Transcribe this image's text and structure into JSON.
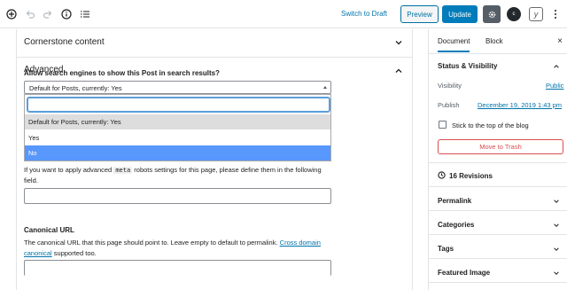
{
  "toolbar": {
    "icons": [
      "add-block-icon",
      "undo-icon",
      "redo-icon",
      "info-icon",
      "list-view-icon"
    ],
    "switch_to_draft": "Switch to Draft",
    "preview": "Preview",
    "update": "Update",
    "yoast_glyph": "y",
    "plugin_glyph": "c"
  },
  "main": {
    "panels": [
      {
        "title": "Cornerstone content",
        "state": "collapsed"
      },
      {
        "title": "Advanced",
        "state": "expanded"
      }
    ],
    "advanced": {
      "search_question": "Allow search engines to show this Post in search results?",
      "select_value": "Default for Posts, currently: Yes",
      "dropdown_options": [
        {
          "label": "Default for Posts, currently: Yes",
          "state": "selected"
        },
        {
          "label": "Yes",
          "state": ""
        },
        {
          "label": "No",
          "state": "highlighted"
        }
      ],
      "meta_desc_before": "If you want to apply advanced ",
      "meta_code": "meta",
      "meta_desc_after": " robots settings for this page, please define them in the following field.",
      "canonical_label": "Canonical URL",
      "canonical_desc_before": "The canonical URL that this page should point to. Leave empty to default to permalink. ",
      "canonical_link": "Cross domain canonical",
      "canonical_desc_after": " supported too."
    }
  },
  "sidebar": {
    "tabs": [
      {
        "label": "Document",
        "active": true
      },
      {
        "label": "Block",
        "active": false
      }
    ],
    "close_glyph": "×",
    "status_title": "Status & Visibility",
    "visibility_label": "Visibility",
    "visibility_value": "Public",
    "publish_label": "Publish",
    "publish_value": "December 19, 2019 1:43 pm",
    "sticky_label": "Stick to the top of the blog",
    "trash_label": "Move to Trash",
    "revisions_label": "16 Revisions",
    "sections": [
      "Permalink",
      "Categories",
      "Tags",
      "Featured Image"
    ]
  },
  "colors": {
    "accent": "#007cba",
    "link": "#0073aa",
    "danger": "#d94f4f",
    "highlight": "#5897fb"
  }
}
